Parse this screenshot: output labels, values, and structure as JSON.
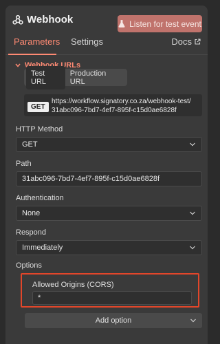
{
  "node": {
    "title": "Webhook",
    "listen_button": "Listen for test event"
  },
  "tabs": {
    "parameters": "Parameters",
    "settings": "Settings",
    "docs": "Docs"
  },
  "webhook_urls": {
    "section_title": "Webhook URLs",
    "test_tab": "Test URL",
    "production_tab": "Production URL",
    "method_badge": "GET",
    "url_line1": "https://workflow.signatory.co.za/webhook-test/",
    "url_line2": "31abc096-7bd7-4ef7-895f-c15d0ae6828f"
  },
  "fields": {
    "http_method_label": "HTTP Method",
    "http_method_value": "GET",
    "path_label": "Path",
    "path_value": "31abc096-7bd7-4ef7-895f-c15d0ae6828f",
    "authentication_label": "Authentication",
    "authentication_value": "None",
    "respond_label": "Respond",
    "respond_value": "Immediately",
    "options_label": "Options"
  },
  "options": {
    "allowed_origins_label": "Allowed Origins (CORS)",
    "allowed_origins_value": "*",
    "add_option": "Add option"
  },
  "colors": {
    "accent": "#ff8a73",
    "listen_button_bg": "#c0736c",
    "highlight_border": "#e2462a"
  },
  "icons": {
    "node": "webhook-icon",
    "listen": "flask-icon",
    "docs": "external-link-icon",
    "section": "chevron-down-icon",
    "select": "chevron-down-icon"
  }
}
